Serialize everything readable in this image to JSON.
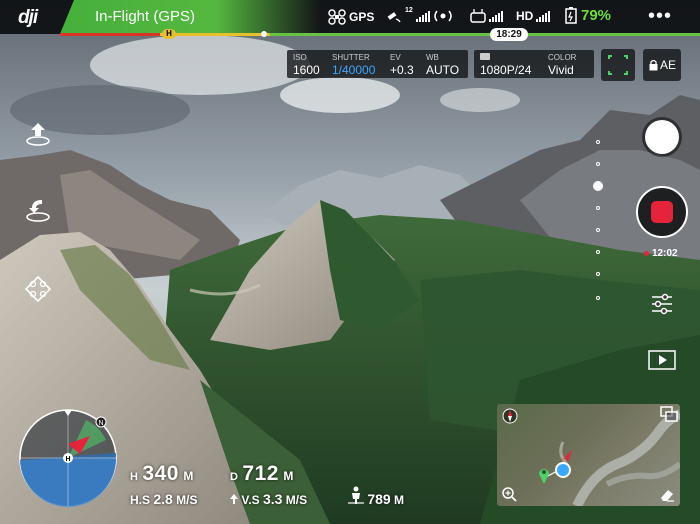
{
  "app": {
    "logo": "dji",
    "status": "In-Flight (GPS)"
  },
  "topbar": {
    "gps_label": "GPS",
    "satellites": "12",
    "video_label": "HD",
    "battery_percent": "79%",
    "more_label": "•••",
    "flight_time": "18:29"
  },
  "camera": {
    "iso_label": "ISO",
    "iso_value": "1600",
    "shutter_label": "SHUTTER",
    "shutter_value": "1/40000",
    "ev_label": "EV",
    "ev_value": "+0.3",
    "wb_label": "WB",
    "wb_value": "AUTO",
    "resolution_value": "1080P/24",
    "color_label": "COLOR",
    "color_value": "Vivid",
    "ae_lock_label": "AE"
  },
  "recording": {
    "time": "12:02"
  },
  "telemetry": {
    "height_label": "H",
    "height_value": "340",
    "height_unit": "M",
    "distance_label": "D",
    "distance_value": "712",
    "distance_unit": "M",
    "hspeed_label": "H.S",
    "hspeed_value": "2.8",
    "hspeed_unit": "M/S",
    "vspeed_label": "V.S",
    "vspeed_value": "3.3",
    "vspeed_unit": "M/S",
    "pilot_distance_value": "789",
    "pilot_distance_unit": "M"
  },
  "radar": {
    "home_label": "H",
    "north_label": "N"
  },
  "colors": {
    "status_green": "#45b03c",
    "battery_green": "#6ddc3a",
    "record_red": "#e5233b",
    "shutter_blue": "#3aa8ff",
    "accent_yellow": "#e6c12c"
  },
  "icons": {
    "takeoff": "takeoff-icon",
    "return_home": "return-to-home-icon",
    "intelligent_flight": "intelligent-flight-mode-icon",
    "camera_settings": "camera-settings-sliders-icon",
    "playback": "playback-icon",
    "focus": "focus-frame-icon",
    "lock": "lock-icon"
  }
}
